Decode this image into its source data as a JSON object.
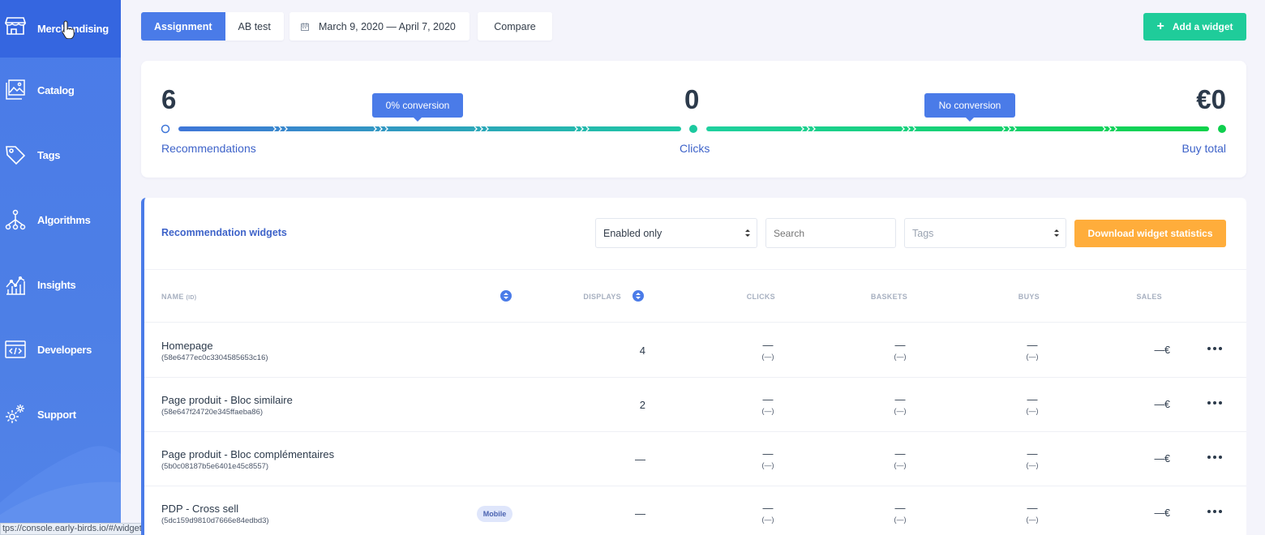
{
  "sidebar": {
    "items": [
      {
        "label": "Merchandising",
        "icon": "storefront-icon",
        "active": true
      },
      {
        "label": "Catalog",
        "icon": "catalog-images-icon"
      },
      {
        "label": "Tags",
        "icon": "tag-icon"
      },
      {
        "label": "Algorithms",
        "icon": "algorithm-tree-icon"
      },
      {
        "label": "Insights",
        "icon": "line-chart-icon"
      },
      {
        "label": "Developers",
        "icon": "code-icon"
      },
      {
        "label": "Support",
        "icon": "gears-icon"
      }
    ]
  },
  "toolbar": {
    "tabs": [
      {
        "label": "Assignment",
        "active": true
      },
      {
        "label": "AB test",
        "active": false
      }
    ],
    "date_range": "March 9, 2020 — April 7, 2020",
    "compare_label": "Compare",
    "add_widget_label": "Add a widget"
  },
  "funnel": {
    "recommendations": {
      "value": "6",
      "label": "Recommendations"
    },
    "clicks": {
      "value": "0",
      "label": "Clicks"
    },
    "buy_total": {
      "value": "€0",
      "label": "Buy total"
    },
    "conversion_1": "0% conversion",
    "conversion_2": "No conversion"
  },
  "widgets": {
    "title": "Recommendation widgets",
    "filter_value": "Enabled only",
    "search_placeholder": "Search",
    "tags_placeholder": "Tags",
    "download_label": "Download widget statistics",
    "columns": {
      "name": "NAME",
      "name_sub": "(ID)",
      "displays": "DISPLAYS",
      "clicks": "CLICKS",
      "baskets": "BASKETS",
      "buys": "BUYS",
      "sales": "SALES"
    },
    "rows": [
      {
        "name": "Homepage",
        "id": "(58e6477ec0c3304585653c16)",
        "badge": "",
        "displays": "4",
        "clicks": "—",
        "clicks_sub": "(—)",
        "baskets": "—",
        "baskets_sub": "(—)",
        "buys": "—",
        "buys_sub": "(—)",
        "sales": "—€"
      },
      {
        "name": "Page produit - Bloc similaire",
        "id": "(58e647f24720e345ffaeba86)",
        "badge": "",
        "displays": "2",
        "clicks": "—",
        "clicks_sub": "(—)",
        "baskets": "—",
        "baskets_sub": "(—)",
        "buys": "—",
        "buys_sub": "(—)",
        "sales": "—€"
      },
      {
        "name": "Page produit - Bloc complémentaires",
        "id": "(5b0c08187b5e6401e45c8557)",
        "badge": "",
        "displays": "—",
        "clicks": "—",
        "clicks_sub": "(—)",
        "baskets": "—",
        "baskets_sub": "(—)",
        "buys": "—",
        "buys_sub": "(—)",
        "sales": "—€"
      },
      {
        "name": "PDP - Cross sell",
        "id": "(5dc159d9810d7666e84edbd3)",
        "badge": "Mobile",
        "displays": "—",
        "clicks": "—",
        "clicks_sub": "(—)",
        "baskets": "—",
        "baskets_sub": "(—)",
        "buys": "—",
        "buys_sub": "(—)",
        "sales": "—€"
      }
    ]
  },
  "status_url": "tps://console.early-birds.io/#/widgets",
  "colors": {
    "primary": "#4a7be8",
    "sidebar_active": "#3566e0",
    "success": "#1fcc9a",
    "warning": "#ffad3b",
    "label_blue": "#3e63c9"
  }
}
